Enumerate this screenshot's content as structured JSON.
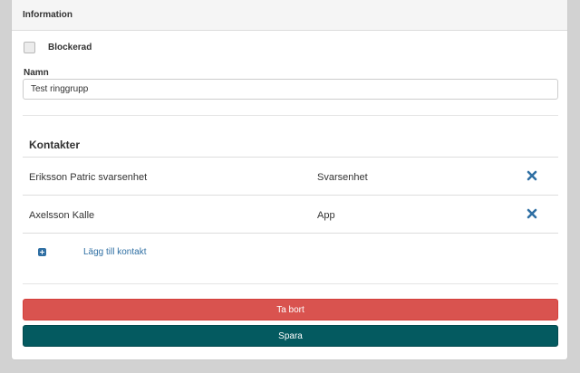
{
  "panel": {
    "heading": "Information"
  },
  "form": {
    "blocked_label": "Blockerad",
    "blocked_checked": false,
    "name_label": "Namn",
    "name_value": "Test ringgrupp"
  },
  "contacts": {
    "title": "Kontakter",
    "rows": [
      {
        "name": "Eriksson Patric svarsenhet",
        "type": "Svarsenhet",
        "remove_icon": "times-icon"
      },
      {
        "name": "Axelsson Kalle",
        "type": "App",
        "remove_icon": "times-icon"
      }
    ],
    "add_label": "Lägg till kontakt",
    "add_icon": "plus-square-icon"
  },
  "actions": {
    "delete_label": "Ta bort",
    "save_label": "Spara"
  },
  "colors": {
    "link": "#2f6fa3",
    "danger": "#d9534f",
    "primary": "#045a60"
  }
}
